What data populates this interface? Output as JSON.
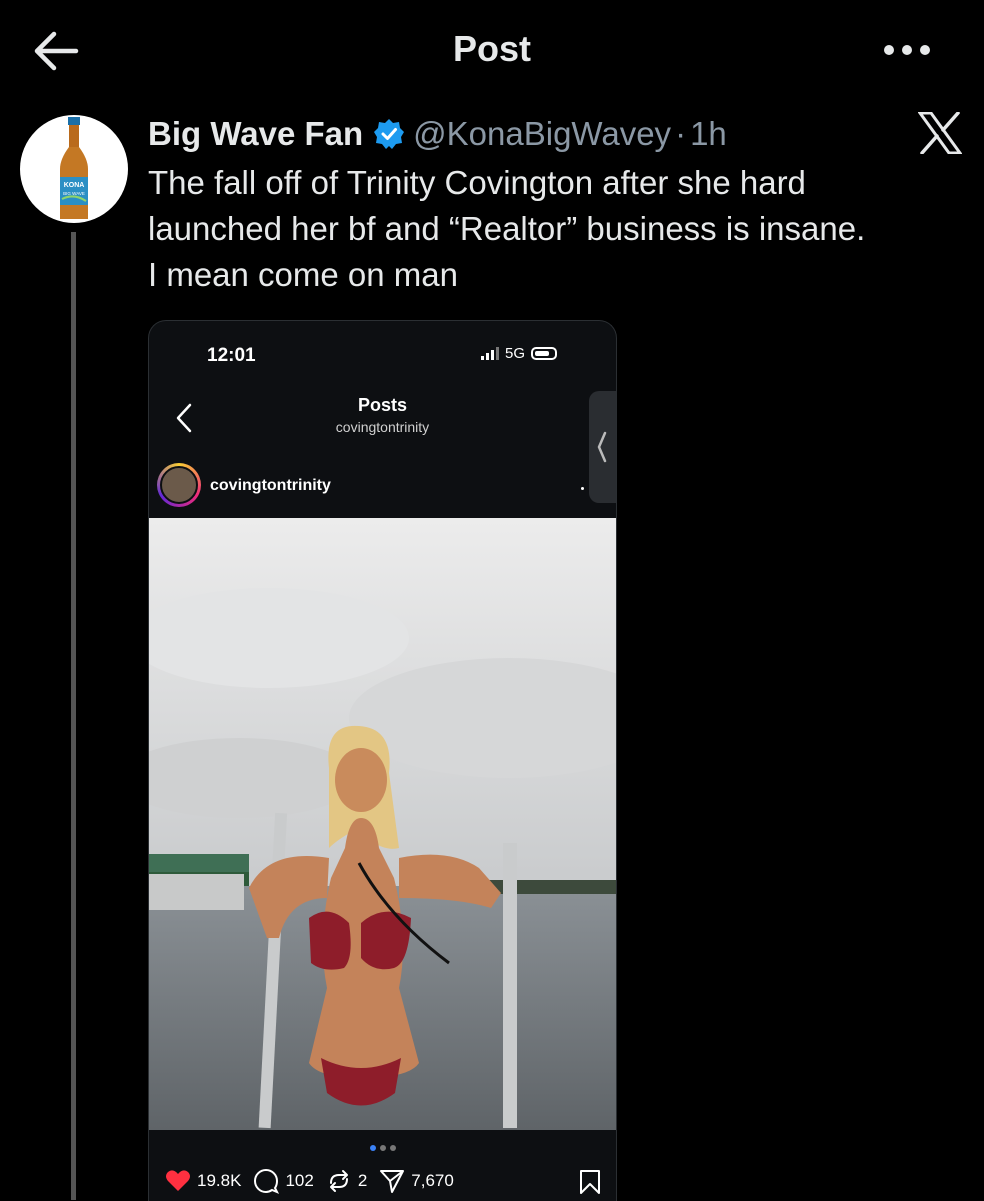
{
  "header": {
    "title": "Post"
  },
  "tweet": {
    "author_name": "Big Wave Fan",
    "handle": "@KonaBigWavey",
    "separator": "·",
    "time": "1h",
    "text": "The fall off of Trinity Covington after she hard\nlaunched her bf and “Realtor” business is insane.\nI mean come on man",
    "avatar_label_top": "KONA",
    "avatar_label_bottom": "BIG WAVE"
  },
  "embedded_screenshot": {
    "status_time": "12:01",
    "network": "5G",
    "page_title": "Posts",
    "page_subtitle": "covingtontrinity",
    "username": "covingtontrinity",
    "likes": "19.8K",
    "comments": "102",
    "reposts": "2",
    "shares": "7,670"
  },
  "colors": {
    "background": "#000000",
    "verified_badge": "#1d9bf0",
    "like_heart": "#ff3040",
    "carousel_active": "#3b82f6"
  }
}
